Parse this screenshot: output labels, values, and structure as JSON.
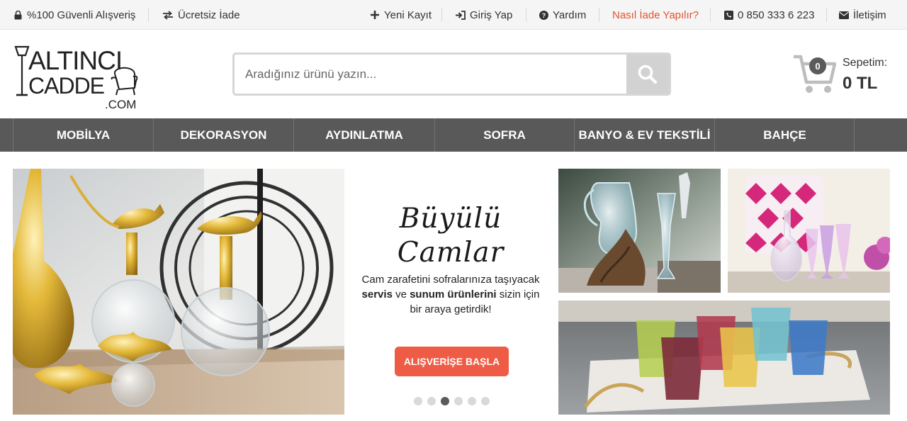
{
  "topbar": {
    "secure": "%100 Güvenli Alışveriş",
    "free_return": "Ücretsiz İade",
    "register": "Yeni Kayıt",
    "login": "Giriş Yap",
    "help": "Yardım",
    "how_return": "Nasıl İade Yapılır?",
    "phone": "0 850 333 6 223",
    "contact": "İletişim"
  },
  "logo": {
    "line1": "ALTINCI",
    "line2": "CADDE",
    "line3": ".COM"
  },
  "search": {
    "placeholder": "Aradığınız ürünü yazın..."
  },
  "cart": {
    "count": "0",
    "title": "Sepetim:",
    "total": "0 TL"
  },
  "nav": {
    "items": [
      "MOBİLYA",
      "DEKORASYON",
      "AYDINLATMA",
      "SOFRA",
      "BANYO & EV TEKSTİLİ",
      "BAHÇE"
    ]
  },
  "hero": {
    "title_line1": "Büyülü",
    "title_line2": "Camlar",
    "desc_line1": "Cam zarafetini sofralarınıza taşıyacak",
    "desc_bold1": "servis",
    "desc_mid": "ve",
    "desc_bold2": "sunum ürünlerini",
    "desc_end": "sizin için",
    "desc_line3": "bir araya getirdik!",
    "cta": "ALIŞVERİŞE BAŞLA",
    "active_slide": 3,
    "slide_count": 6
  },
  "colors": {
    "accent": "#ef5c45",
    "nav_bg": "#595959",
    "link_orange": "#e2532d"
  }
}
